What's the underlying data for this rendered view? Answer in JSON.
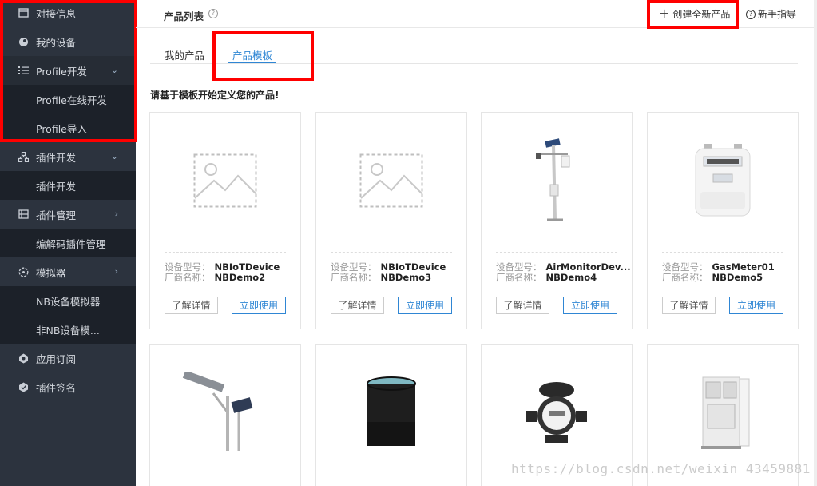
{
  "sidebar": {
    "items": [
      {
        "label": "对接信息",
        "icon": "window-icon"
      },
      {
        "label": "我的设备",
        "icon": "device-icon"
      },
      {
        "label": "Profile开发",
        "icon": "list-icon",
        "chevron": "down"
      },
      {
        "label": "Profile在线开发"
      },
      {
        "label": "Profile导入"
      },
      {
        "label": "插件开发",
        "icon": "plugin-tree-icon",
        "chevron": "down"
      },
      {
        "label": "插件开发"
      },
      {
        "label": "插件管理",
        "icon": "grid-icon",
        "chevron": "right"
      },
      {
        "label": "编解码插件管理"
      },
      {
        "label": "模拟器",
        "icon": "simulator-icon",
        "chevron": "right"
      },
      {
        "label": "NB设备模拟器"
      },
      {
        "label": "非NB设备模..."
      },
      {
        "label": "应用订阅",
        "icon": "subscribe-icon"
      },
      {
        "label": "插件签名",
        "icon": "signature-icon"
      }
    ]
  },
  "header": {
    "title": "产品列表",
    "help": "?",
    "create_label": "创建全新产品",
    "guide_label": "新手指导"
  },
  "tabs": [
    {
      "label": "我的产品"
    },
    {
      "label": "产品模板"
    }
  ],
  "prompt": "请基于模板开始定义您的产品!",
  "card_labels": {
    "model": "设备型号：",
    "vendor": "厂商名称：",
    "detail": "了解详情",
    "use": "立即使用"
  },
  "cards": [
    {
      "model": "NBIoTDevice",
      "vendor": "NBDemo2",
      "image": "placeholder-image"
    },
    {
      "model": "NBIoTDevice",
      "vendor": "NBDemo3",
      "image": "placeholder-image"
    },
    {
      "model": "AirMonitorDev...",
      "vendor": "NBDemo4",
      "image": "weather-station"
    },
    {
      "model": "GasMeter01",
      "vendor": "NBDemo5",
      "image": "gas-meter"
    },
    {
      "image": "street-light"
    },
    {
      "image": "black-cylinder-sensor"
    },
    {
      "image": "water-meter"
    },
    {
      "image": "electrical-cabinet"
    }
  ],
  "watermark": "https://blog.csdn.net/weixin_43459881",
  "colors": {
    "sidebar_bg": "#2c333e",
    "accent": "#2f86d4",
    "highlight_box": "#ff0000"
  }
}
